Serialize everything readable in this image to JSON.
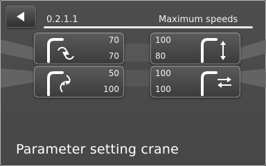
{
  "header": {
    "menu_code": "0.2.1.1",
    "title": "Maximum speeds"
  },
  "back_button": {
    "icon": "back-triangle-icon"
  },
  "cards": [
    {
      "id": "slew",
      "icon": "crane-slew-icon",
      "upper": "70",
      "lower": "70"
    },
    {
      "id": "luff",
      "icon": "crane-luff-icon",
      "upper": "100",
      "lower": "80"
    },
    {
      "id": "fold",
      "icon": "crane-fold-icon",
      "upper": "50",
      "lower": "100"
    },
    {
      "id": "telescope",
      "icon": "crane-telescope-icon",
      "upper": "100",
      "lower": "100"
    }
  ],
  "footer": {
    "label": "Parameter setting crane"
  },
  "colors": {
    "background": "#4a4a4a",
    "text": "#ffffff",
    "line": "#eaeaea"
  }
}
